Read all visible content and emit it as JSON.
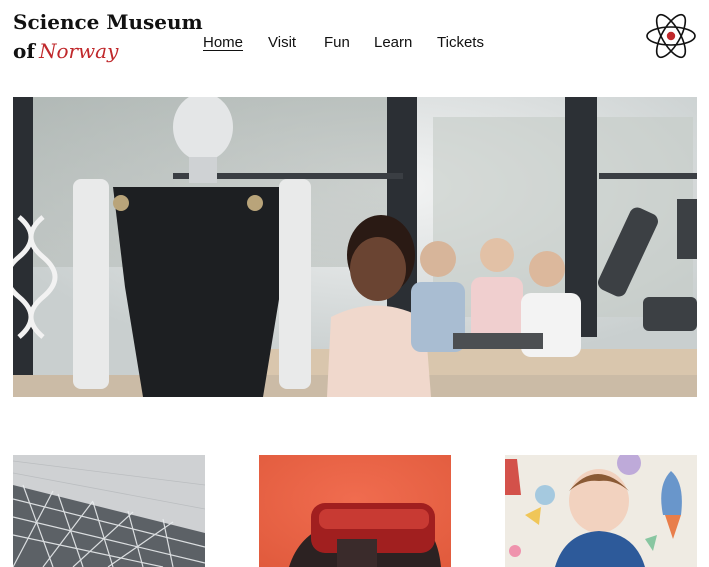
{
  "logo": {
    "line1": "Science Museum",
    "line2_prefix": "of",
    "line2_highlight": "Norway",
    "highlight_color": "#c0282b"
  },
  "nav": {
    "items": [
      {
        "label": "Home",
        "active": true
      },
      {
        "label": "Visit"
      },
      {
        "label": "Fun"
      },
      {
        "label": "Learn"
      },
      {
        "label": "Tickets"
      }
    ]
  },
  "icons": {
    "logo_mark": "atom-icon"
  },
  "hero": {
    "image": "photo-robot-and-children-in-lab"
  },
  "cards": [
    {
      "image": "photo-modern-glass-building"
    },
    {
      "image": "photo-vr-headset-on-orange"
    },
    {
      "image": "photo-boy-with-rocket-wallpaper"
    }
  ]
}
